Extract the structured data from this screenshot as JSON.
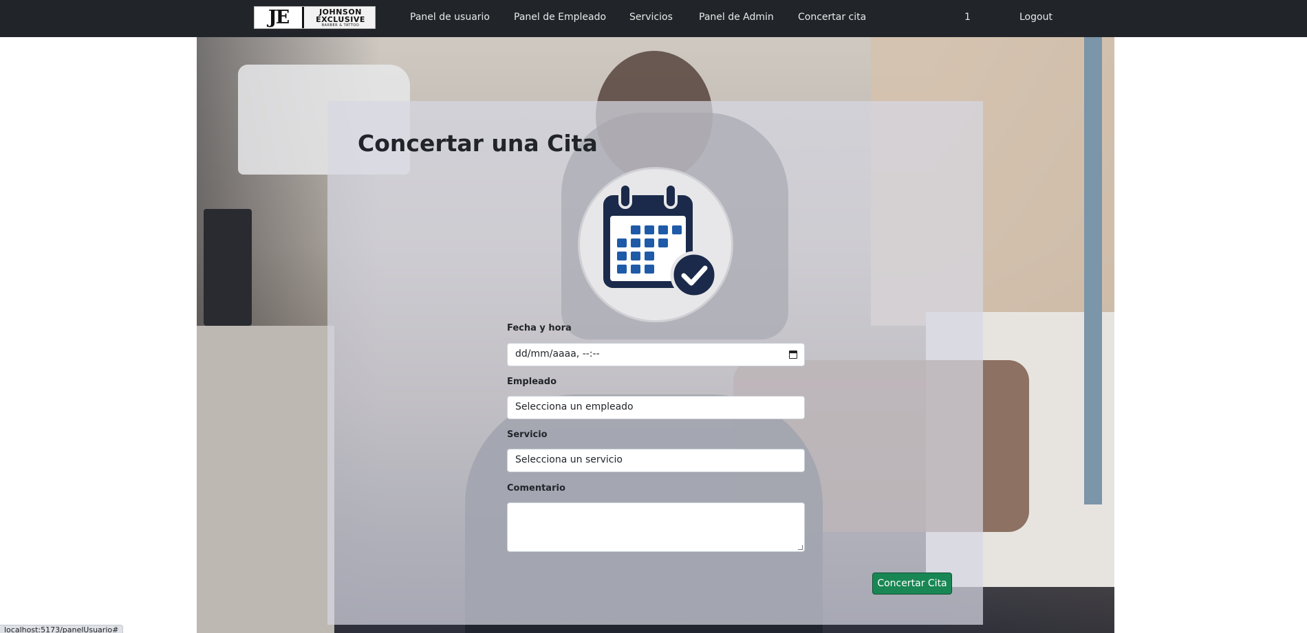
{
  "navbar": {
    "brand": {
      "monogram": "JE",
      "line1": "JOHNSON",
      "line2": "EXCLUSIVE",
      "line3": "BARBER & TATTOO"
    },
    "links": [
      {
        "label": "Panel de usuario"
      },
      {
        "label": "Panel de Empleado"
      },
      {
        "label": "Servicios"
      },
      {
        "label": "Panel de Admin"
      },
      {
        "label": "Concertar cita"
      }
    ],
    "user_id": "1",
    "logout_label": "Logout"
  },
  "form": {
    "title": "Concertar una Cita",
    "icon": "calendar-check-icon",
    "fields": {
      "datetime": {
        "label": "Fecha y hora",
        "value": "dd/mm/aaaa, --:--"
      },
      "employee": {
        "label": "Empleado",
        "value": "Selecciona un empleado"
      },
      "service": {
        "label": "Servicio",
        "value": "Selecciona un servicio"
      },
      "comment": {
        "label": "Comentario",
        "value": ""
      }
    },
    "submit_label": "Concertar Cita"
  },
  "status_bar": {
    "url": "localhost:5173/panelUsuario#"
  },
  "colors": {
    "navbar": "#212529",
    "submit": "#198754",
    "calendar": "#1b2a4a"
  }
}
